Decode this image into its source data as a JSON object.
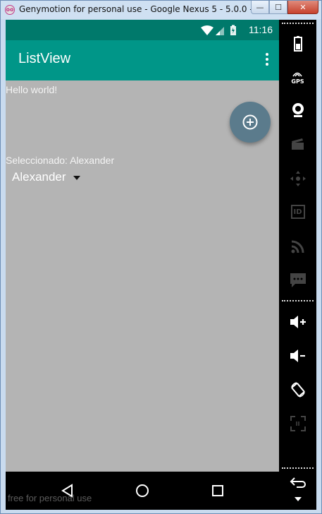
{
  "window": {
    "title": "Genymotion for personal use - Google Nexus 5 - 5.0.0 - ...",
    "minimize_glyph": "—",
    "maximize_glyph": "☐",
    "close_glyph": "✕"
  },
  "statusbar": {
    "time": "11:16"
  },
  "appbar": {
    "title": "ListView"
  },
  "content": {
    "hello": "Hello world!",
    "selected_label": "Seleccionado: Alexander",
    "spinner_value": "Alexander"
  },
  "watermark": "free for personal use",
  "colors": {
    "statusbar": "#00796b",
    "appbar": "#009688",
    "fab": "#5b7b8c",
    "content_bg": "#b4b4b4"
  },
  "side_panel": {
    "gps_label": "GPS",
    "id_label": "ID",
    "icons": [
      "battery-icon",
      "gps-icon",
      "camera-icon",
      "clapperboard-icon",
      "dpad-icon",
      "id-icon",
      "rss-icon",
      "sms-icon",
      "volume-up-icon",
      "volume-down-icon",
      "rotate-icon",
      "pixel-perfect-icon",
      "back-icon",
      "chevron-down-icon"
    ]
  }
}
